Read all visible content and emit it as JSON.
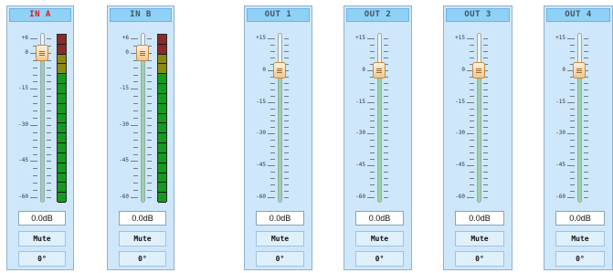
{
  "channels": [
    {
      "name": "IN A",
      "active": true,
      "type": "input",
      "gain": "0.0dB",
      "mute": "Mute",
      "phase": "0°",
      "scale": [
        "+6",
        "0",
        "-15",
        "-30",
        "-45",
        "-60"
      ],
      "fader_db": 0,
      "meter": {
        "total": 17,
        "red": 2,
        "yellow": 2
      }
    },
    {
      "name": "IN B",
      "active": false,
      "type": "input",
      "gain": "0.0dB",
      "mute": "Mute",
      "phase": "0°",
      "scale": [
        "+6",
        "0",
        "-15",
        "-30",
        "-45",
        "-60"
      ],
      "fader_db": 0,
      "meter": {
        "total": 17,
        "red": 2,
        "yellow": 2
      }
    },
    {
      "name": "OUT 1",
      "active": false,
      "type": "output",
      "gain": "0.0dB",
      "mute": "Mute",
      "phase": "0°",
      "scale": [
        "+15",
        "0",
        "-15",
        "-30",
        "-45",
        "-60"
      ],
      "fader_db": 0
    },
    {
      "name": "OUT 2",
      "active": false,
      "type": "output",
      "gain": "0.0dB",
      "mute": "Mute",
      "phase": "0°",
      "scale": [
        "+15",
        "0",
        "-15",
        "-30",
        "-45",
        "-60"
      ],
      "fader_db": 0
    },
    {
      "name": "OUT 3",
      "active": false,
      "type": "output",
      "gain": "0.0dB",
      "mute": "Mute",
      "phase": "0°",
      "scale": [
        "+15",
        "0",
        "-15",
        "-30",
        "-45",
        "-60"
      ],
      "fader_db": 0
    },
    {
      "name": "OUT 4",
      "active": false,
      "type": "output",
      "gain": "0.0dB",
      "mute": "Mute",
      "phase": "0°",
      "scale": [
        "+15",
        "0",
        "-15",
        "-30",
        "-45",
        "-60"
      ],
      "fader_db": 0
    }
  ],
  "colors": {
    "panel": "#cfe7fa",
    "header": "#8fd1f7",
    "active_header_text": "#ee1111",
    "meter_red": "#8b2a2a",
    "meter_yellow": "#8a8a12",
    "meter_green": "#139a1f"
  }
}
